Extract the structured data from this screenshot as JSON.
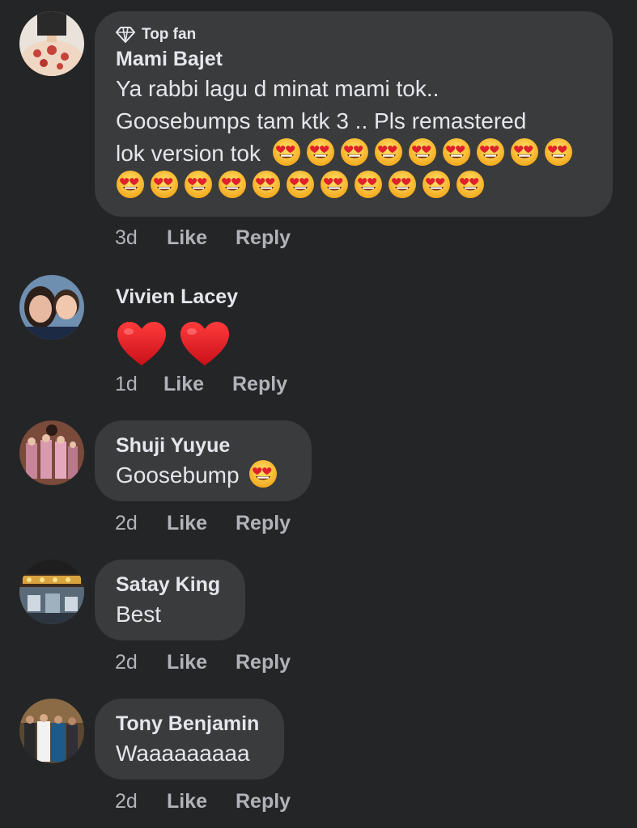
{
  "colors": {
    "background": "#242526",
    "bubble": "#3a3b3c",
    "text_primary": "#e4e6eb",
    "text_secondary": "#b0b3b8"
  },
  "comments": [
    {
      "badge": "Top fan",
      "badge_icon": "diamond-icon",
      "author": "Mami Bajet",
      "text_lines": [
        "Ya rabbi lagu d minat mami tok..",
        "Goosebumps tam ktk 3 .. Pls remastered",
        "lok version tok"
      ],
      "emoji_icon": "heart-eyes-emoji",
      "emoji_count": 20,
      "time": "3d",
      "like": "Like",
      "reply": "Reply"
    },
    {
      "author": "Vivien Lacey",
      "hearts_icon": "red-heart-emoji",
      "hearts_count": 2,
      "time": "1d",
      "like": "Like",
      "reply": "Reply"
    },
    {
      "author": "Shuji Yuyue",
      "text": "Goosebump",
      "emoji_icon": "heart-eyes-emoji",
      "emoji_count": 1,
      "time": "2d",
      "like": "Like",
      "reply": "Reply"
    },
    {
      "author": "Satay King",
      "text": "Best",
      "time": "2d",
      "like": "Like",
      "reply": "Reply"
    },
    {
      "author": "Tony Benjamin",
      "text": "Waaaaaaaaa",
      "time": "2d",
      "like": "Like",
      "reply": "Reply"
    }
  ]
}
